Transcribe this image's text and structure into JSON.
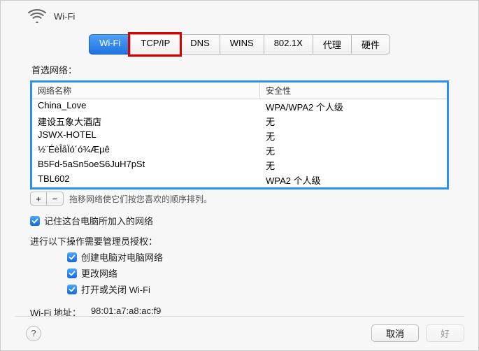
{
  "header": {
    "title": "Wi-Fi"
  },
  "tabs": [
    {
      "label": "Wi-Fi",
      "active": true
    },
    {
      "label": "TCP/IP",
      "highlighted": true
    },
    {
      "label": "DNS"
    },
    {
      "label": "WINS"
    },
    {
      "label": "802.1X"
    },
    {
      "label": "代理"
    },
    {
      "label": "硬件"
    }
  ],
  "preferred_label": "首选网络：",
  "table": {
    "columns": {
      "name": "网络名称",
      "security": "安全性"
    },
    "rows": [
      {
        "name": "China_Love",
        "security": "WPA/WPA2 个人级"
      },
      {
        "name": "建设五象大酒店",
        "security": "无"
      },
      {
        "name": "JSWX-HOTEL",
        "security": "无"
      },
      {
        "name": "½¨ÉèÎåÏó´ó¾Æµê",
        "security": "无"
      },
      {
        "name": "B5Fd-5aSn5oeS6JuH7pSt",
        "security": "无"
      },
      {
        "name": "TBL602",
        "security": "WPA2 个人级"
      }
    ]
  },
  "drag_hint": "拖移网络使它们按您喜欢的顺序排列。",
  "remember_label": "记住这台电脑所加入的网络",
  "admin_label": "进行以下操作需要管理员授权：",
  "admin_opts": {
    "create": "创建电脑对电脑网络",
    "change": "更改网络",
    "toggle": "打开或关闭 Wi-Fi"
  },
  "wifi_addr_label": "Wi-Fi 地址：",
  "wifi_addr_value": "98:01:a7:a8:ac:f9",
  "footer": {
    "cancel": "取消",
    "ok": "好"
  }
}
